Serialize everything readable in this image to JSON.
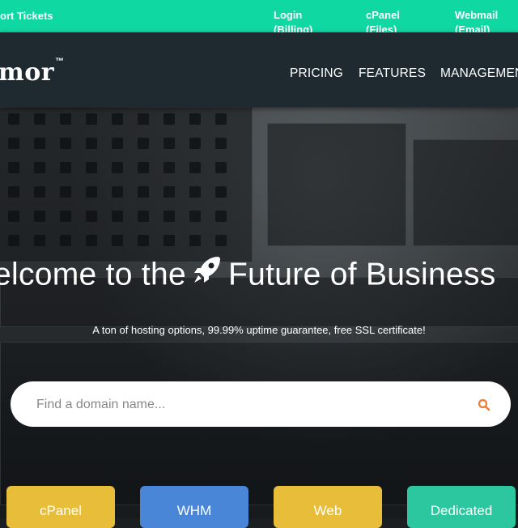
{
  "topbar": {
    "tickets": "ort Tickets",
    "login": {
      "line1": "Login",
      "line2": "(Billing)"
    },
    "cpanel": {
      "line1": "cPanel",
      "line2": "(Files)"
    },
    "webmail": {
      "line1": "Webmail",
      "line2": "(Email)"
    }
  },
  "navbar": {
    "logo": "mor",
    "logo_tm": "™",
    "items": [
      "PRICING",
      "FEATURES",
      "MANAGEMENT"
    ]
  },
  "hero": {
    "headline_left": "elcome to the",
    "headline_right": "Future of Business",
    "rocket_icon": "rocket-icon",
    "tagline": "A ton of hosting options, 99.99% uptime guarantee, free SSL certificate!"
  },
  "search": {
    "placeholder": "Find a domain name...",
    "value": "",
    "icon": "search-icon",
    "icon_color": "#f07c2b"
  },
  "cards": [
    {
      "label": "cPanel",
      "color": "#e8bd3a"
    },
    {
      "label": "WHM",
      "color": "#4a86d8"
    },
    {
      "label": "Web",
      "color": "#e8bd3a"
    },
    {
      "label": "Dedicated",
      "color": "#2cc79f"
    }
  ],
  "colors": {
    "topbar": "#0fd8a3",
    "navbar": "#1e2a30"
  }
}
